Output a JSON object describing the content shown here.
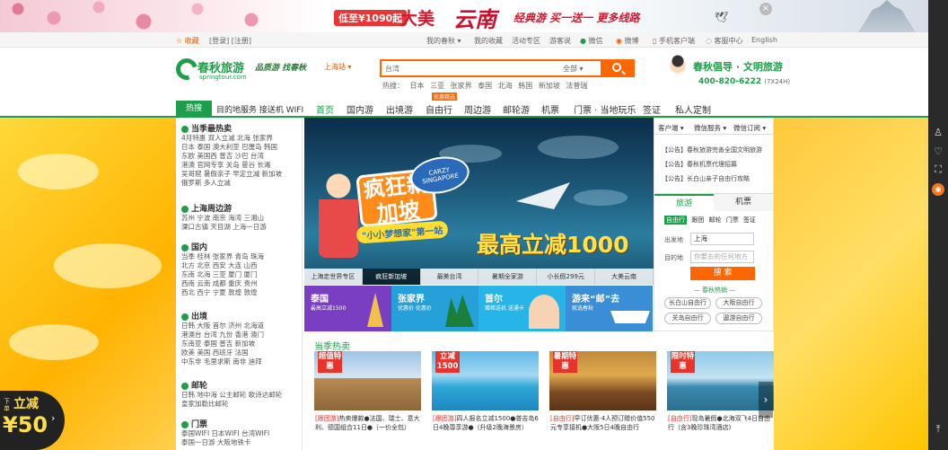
{
  "banner": {
    "price_pill": "低至¥1090起",
    "title_a": "大美",
    "title_b": "云南",
    "slogan": "经典游 买一送一 更多线路",
    "close": "×"
  },
  "topbar": {
    "fav": "☆ 收藏",
    "login": "[登录] [注册]",
    "my_trip": "我的春秋 ▾",
    "my_fav": "我的收藏",
    "activity": "活动专区",
    "forum": "游客说",
    "wechat": "微信",
    "weibo": "微博",
    "mobile": "手机客户端",
    "service": "客服中心",
    "english": "English"
  },
  "header": {
    "logo_name": "春秋旅游",
    "logo_url": "springtour.com",
    "tagline": "品质游 找春秋",
    "city": "上海站 ▾",
    "search_placeholder": "台湾",
    "search_category": "全部 ▾",
    "hot_label": "热搜：",
    "hot_words": [
      "日本",
      "三亚",
      "张家界",
      "泰国",
      "北海",
      "韩国",
      "新加坡",
      "法普瑞"
    ],
    "slogan": "春秋倡导 · 文明旅游",
    "phone": "400-820-6222",
    "phone_note": "(7X24H)"
  },
  "nav": {
    "hot_label": "热搜",
    "service": "目的地服务 接送机 WIFI",
    "items": [
      "首页",
      "国内游",
      "出境游",
      "自由行",
      "周边游",
      "邮轮游",
      "机票",
      "门票 · 当地玩乐",
      "签证",
      "私人定制"
    ],
    "flag": "优惠精选"
  },
  "sidemenu": {
    "sections": [
      {
        "title": "当季最热卖",
        "rows": [
          "4月特惠  双人立减  北海  张家界",
          "日本  泰国  澳大利亚  巴厘岛  韩国",
          "东欧  美国西  普吉  沙巴  台湾",
          "港澳  官网专享  关岛  曼谷  长滩",
          "吴哥窟  暑假亲子  早定立减  新加坡",
          "俄罗斯  多人立减"
        ]
      },
      {
        "title": "上海周边游",
        "rows": [
          "苏州  宁波  南京  海湾  三湘山",
          "溧口古镇  天目湖  上海一日游"
        ]
      },
      {
        "title": "国内",
        "rows": [
          "当季  桂林  张家界  青岛  珠海",
          "北方  北京  西安  大连  山西",
          "东南  北海  三亚  厦门  厦门",
          "西南  云南  成都  重庆  贵州",
          "西北  西宁  宁夏  敦煌  敦煌"
        ]
      },
      {
        "title": "出境",
        "rows": [
          "日韩  大阪  首尔  济州  北海道",
          "港澳台  台湾  九份  香港  澳门",
          "东南亚  泰国  普吉  新加坡",
          "欧美  美国  西班牙  法国",
          "中东非  毛里求斯  南非  迪拜"
        ]
      },
      {
        "title": "邮轮",
        "rows": [
          "日韩  地中海  公主邮轮  歌诗达邮轮",
          "皇家加勒比邮轮"
        ]
      },
      {
        "title": "门票",
        "rows": [
          "泰国WIFI  日本WIFI  台湾WIFI",
          "泰国一日游  大阪地铁卡"
        ]
      }
    ]
  },
  "hero": {
    "title": "疯狂新加坡",
    "badge": "CARZY SINGAPORE",
    "sub": "\"小小梦想家\"第一站",
    "price": "最高立减1000",
    "tabs": [
      "上海走世界专区",
      "疯狂新加坡",
      "最美台湾",
      "暑期全家游",
      "小长假299元",
      "大美云南"
    ]
  },
  "tiles": [
    {
      "title": "泰国",
      "sub": "最高立减1500",
      "color": "#7a3ec2"
    },
    {
      "title": "张家界",
      "sub": "优惠价 优惠价",
      "color": "#26a0d8"
    },
    {
      "title": "首尔",
      "sub": "赠稀送机 送通卡",
      "color": "#27b4e6"
    },
    {
      "title": "游来“邮”去",
      "sub": "就选春秋",
      "color": "#3a8ed6"
    }
  ],
  "rpanel": {
    "tabs": [
      "客户端 ▾",
      "微信服务 ▾",
      "微信订阅 ▾"
    ],
    "notices": [
      "【公告】春秋旅游完善全国文明旅游",
      "【公告】春秋机票代理招募",
      "【公告】长白山亲子自由行攻略"
    ],
    "switch": [
      "旅游",
      "机票"
    ],
    "options": [
      "自由行",
      "跟团",
      "邮轮",
      "门票",
      "签证"
    ],
    "from_label": "出发地",
    "from_value": "上海",
    "to_label": "目的地",
    "to_placeholder": "你要去的任何地方",
    "search": "搜 索",
    "hot_title": "— 春秋热销 —",
    "chips": [
      "长白山自由行",
      "大阪自由行",
      "关岛自由行",
      "遨游自由行"
    ]
  },
  "season": {
    "title": "当季热卖",
    "cards": [
      {
        "tag": "超值特惠",
        "prefix": "[跟团游]",
        "text": "热卖爆款●法国、瑞士、意大利、德国组合11日●（一价全包）",
        "colors": [
          "#9ec3e6",
          "#b98a56"
        ]
      },
      {
        "tag": "立减1500",
        "prefix": "[跟团游]",
        "text": "四人报名立减1500●普吉岛6日4晚尊享游●（升级2晚海景房）",
        "colors": [
          "#5fb8e8",
          "#1f86c2"
        ]
      },
      {
        "tag": "暑期特惠",
        "prefix": "[自由行]",
        "text": "早订优惠·4人预订赠价值550元专享接机●大阪5日4晚自由行",
        "colors": [
          "#c08a3e",
          "#5a3417"
        ]
      },
      {
        "tag": "限时特惠",
        "prefix": "[自由行]",
        "text": "现岛暑假●北海双飞4日自由行（含3晚珍珠湾酒店)",
        "colors": [
          "#8ec9e9",
          "#3b8ab1"
        ]
      }
    ],
    "next": "›"
  },
  "promo": {
    "line1": "下单",
    "line2": "立减",
    "amount": "¥50",
    "arrow": "›"
  },
  "rightbar": {
    "icons": [
      "user-icon",
      "heart-icon",
      "expand-icon",
      "weibo-icon",
      "top-icon"
    ]
  }
}
